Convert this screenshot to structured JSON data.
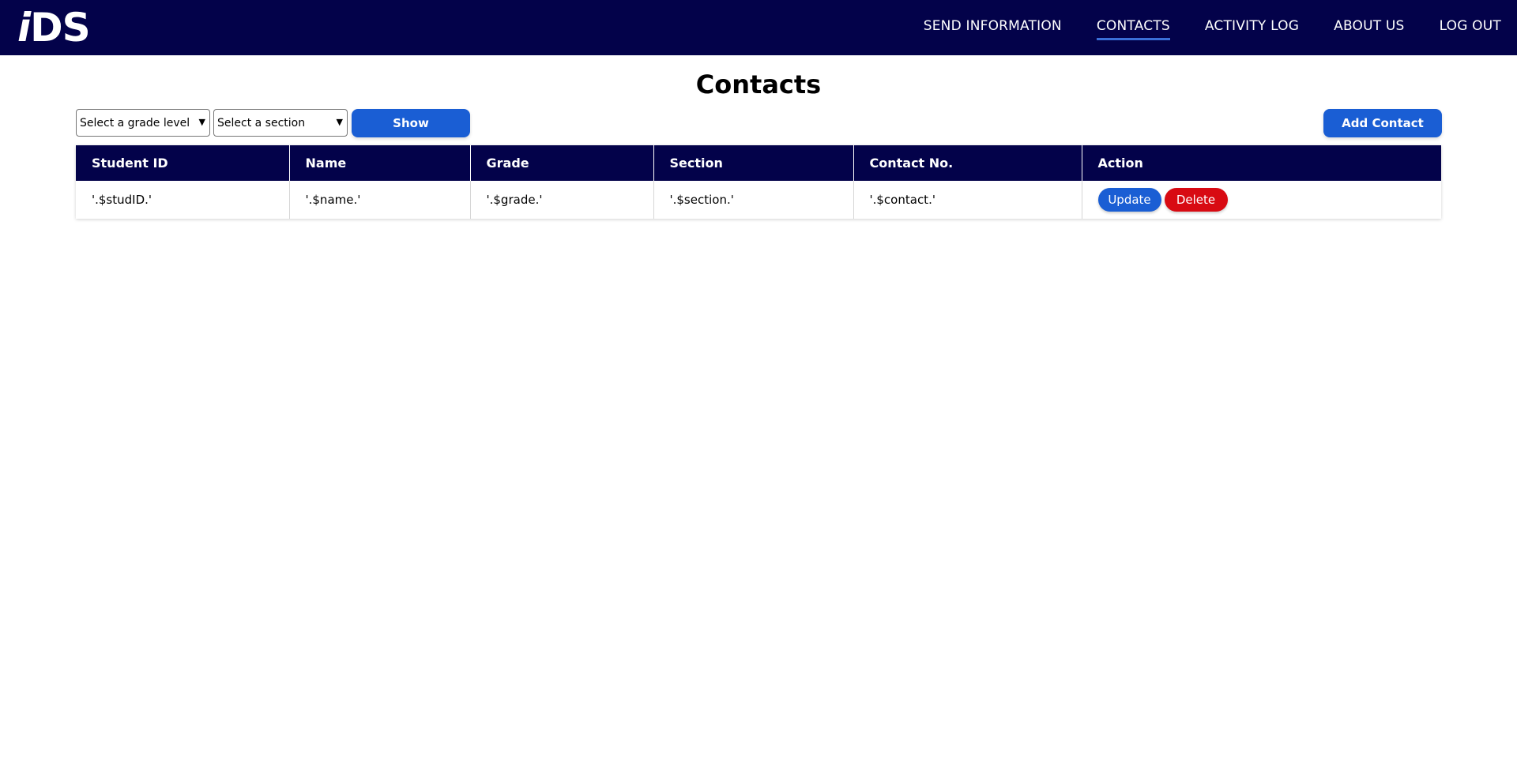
{
  "nav": {
    "logo_text_i": "i",
    "logo_text_rest": "DS",
    "links": [
      {
        "label": "SEND INFORMATION"
      },
      {
        "label": "CONTACTS",
        "active": true
      },
      {
        "label": "ACTIVITY LOG"
      },
      {
        "label": "ABOUT US"
      },
      {
        "label": "LOG OUT"
      }
    ]
  },
  "page": {
    "title": "Contacts"
  },
  "filters": {
    "grade_select": "Select a grade level",
    "section_select": "Select a section",
    "show_label": "Show",
    "add_label": "Add Contact"
  },
  "table": {
    "headers": [
      "Student ID",
      "Name",
      "Grade",
      "Section",
      "Contact No.",
      "Action"
    ],
    "rows": [
      {
        "student_id": "'.$studID.'",
        "name": "'.$name.'",
        "grade": "'.$grade.'",
        "section": "'.$section.'",
        "contact": "'.$contact.'",
        "update_label": "Update",
        "delete_label": "Delete"
      }
    ]
  },
  "colors": {
    "navbar": "#03024a",
    "primary_button": "#1a5ed4",
    "delete_button": "#d80a12"
  }
}
